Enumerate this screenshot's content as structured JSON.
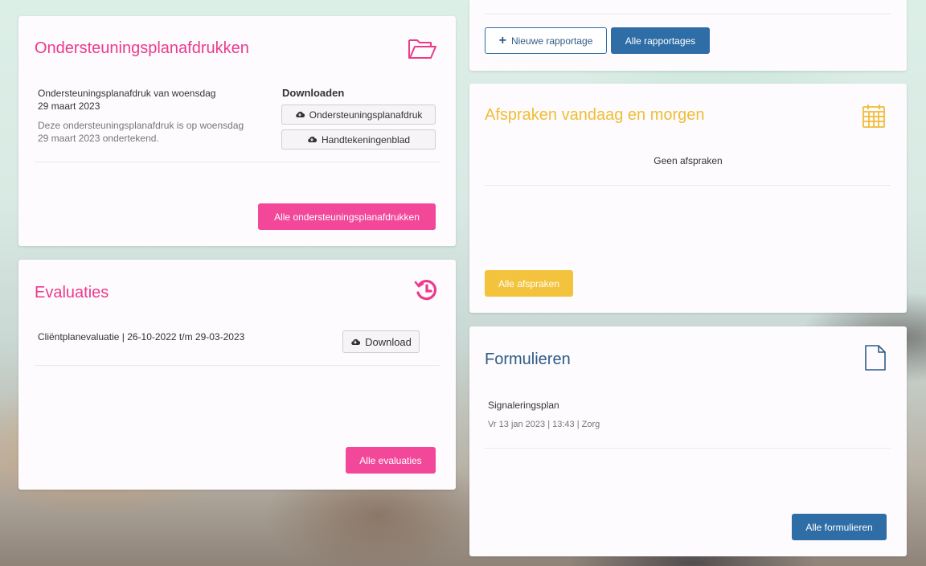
{
  "ondersteuningsplan": {
    "title": "Ondersteuningsplanafdrukken",
    "item_title_line1": "Ondersteuningsplanafdruk van woensdag",
    "item_title_line2": "29 maart 2023",
    "item_desc_line1": "Deze ondersteuningsplanafdruk is op woensdag",
    "item_desc_line2": "29 maart 2023 ondertekend.",
    "downloads_heading": "Downloaden",
    "download_plan_label": "Ondersteuningsplanafdruk",
    "download_sign_label": "Handtekeningenblad",
    "all_button_label": "Alle ondersteuningsplanafdrukken"
  },
  "evaluaties": {
    "title": "Evaluaties",
    "item_text": "Cliëntplanevaluatie | 26-10-2022 t/m 29-03-2023",
    "download_label": "Download",
    "all_button_label": "Alle evaluaties"
  },
  "rapportages": {
    "new_button_label": "Nieuwe rapportage",
    "all_button_label": "Alle rapportages"
  },
  "afspraken": {
    "title": "Afspraken vandaag en morgen",
    "empty_text": "Geen afspraken",
    "all_button_label": "Alle afspraken"
  },
  "formulieren": {
    "title": "Formulieren",
    "item_title": "Signaleringsplan",
    "item_meta": "Vr 13 jan 2023 | 13:43 | Zorg",
    "all_button_label": "Alle formulieren"
  },
  "colors": {
    "pink": "#ec3a8c",
    "yellow": "#f0bd36",
    "blue": "#2f5c85"
  }
}
